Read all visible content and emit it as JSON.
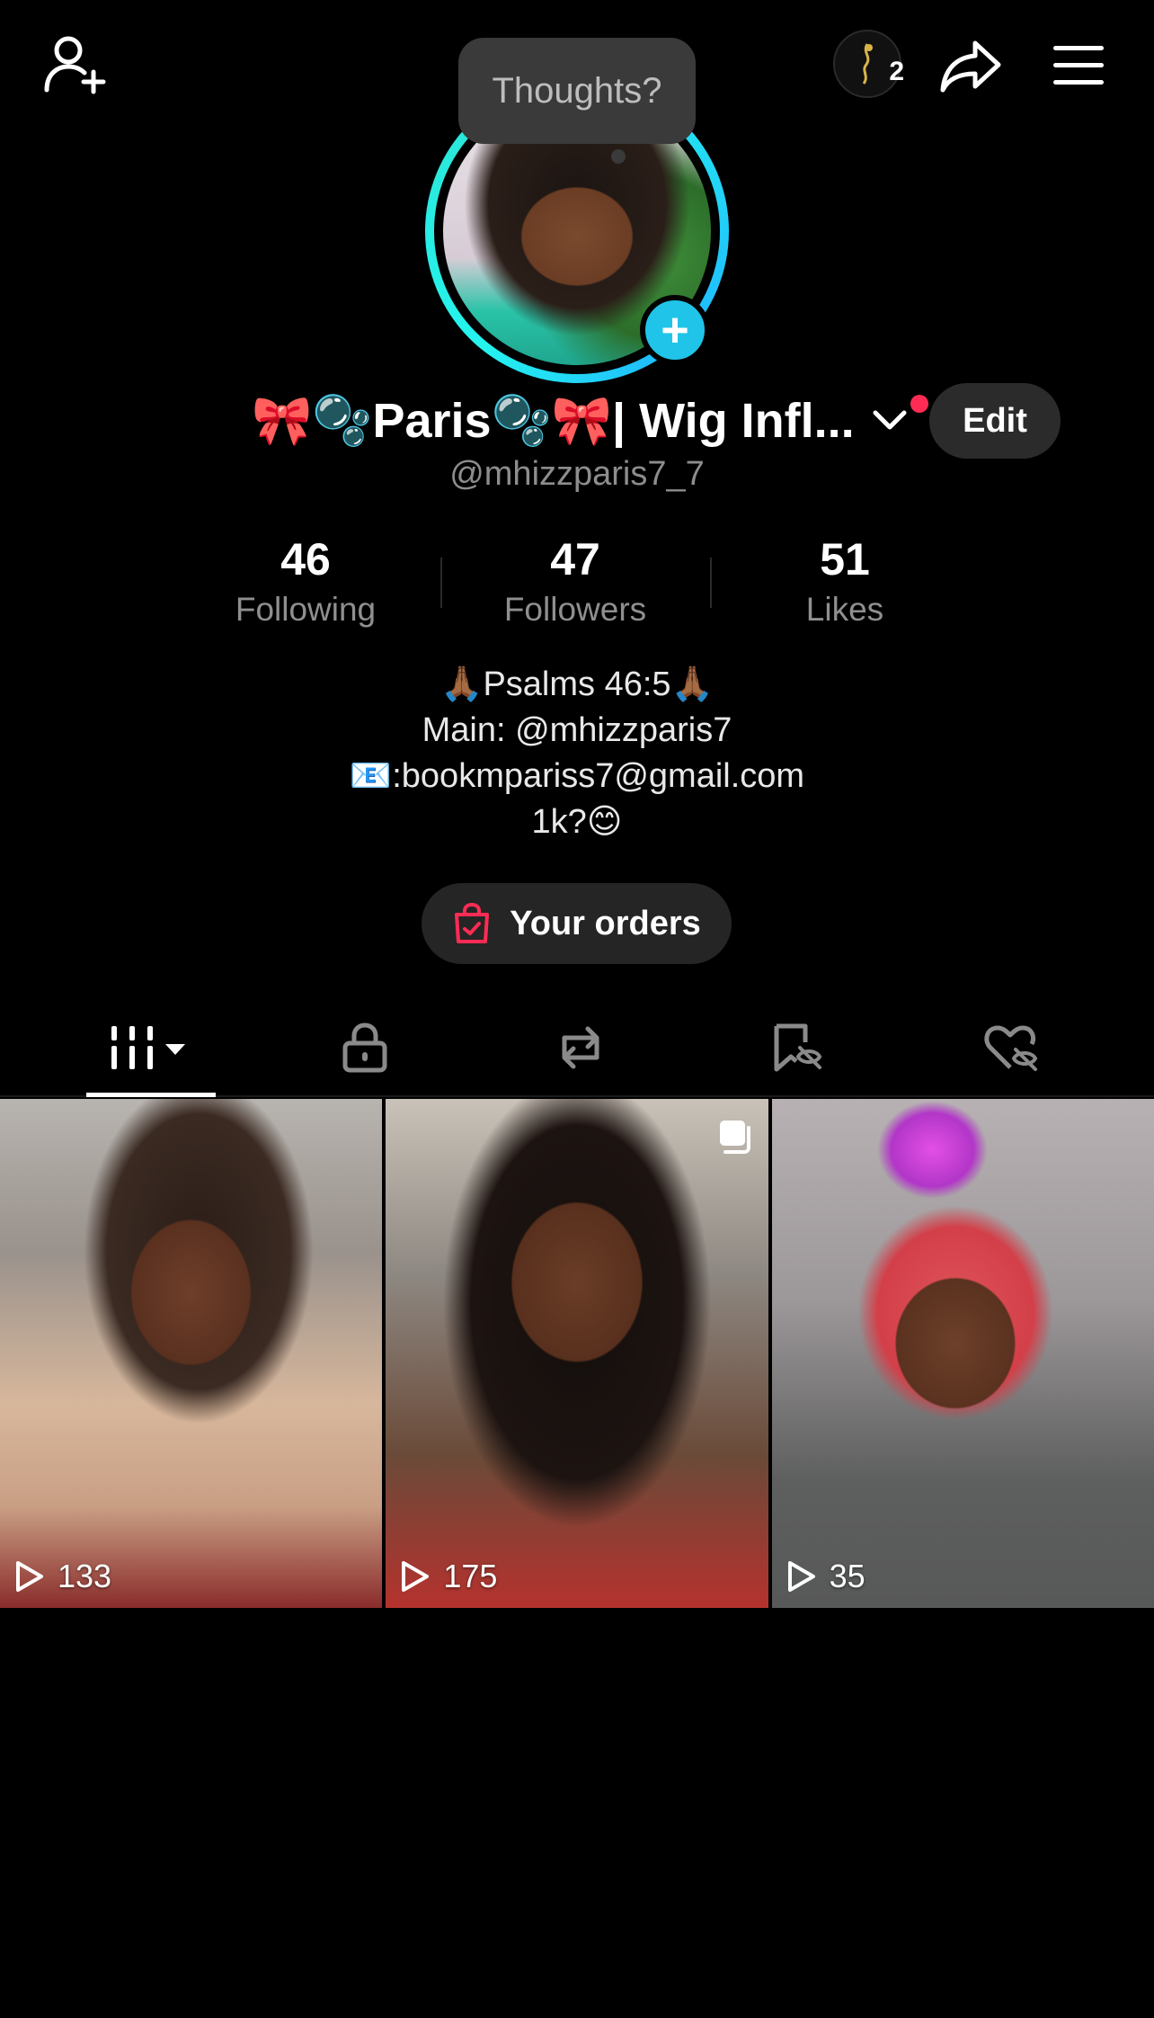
{
  "top_bar": {
    "icons": [
      "add-friend-icon",
      "badge-logo",
      "share-icon",
      "menu-icon"
    ],
    "badge_count": "2"
  },
  "thoughts": {
    "label": "Thoughts?"
  },
  "profile": {
    "display_name": "🎀🫧Paris🫧🎀| Wig Infl...",
    "username": "@mhizzparis7_7",
    "edit_label": "Edit"
  },
  "stats": [
    {
      "value": "46",
      "label": "Following"
    },
    {
      "value": "47",
      "label": "Followers"
    },
    {
      "value": "51",
      "label": "Likes"
    }
  ],
  "bio": {
    "lines": [
      "🙏🏾Psalms 46:5🙏🏾",
      "Main: @mhizzparis7",
      "📧:bookmpariss7@gmail.com",
      "1k?😊"
    ]
  },
  "orders": {
    "label": "Your orders"
  },
  "tabs": [
    {
      "name": "videos",
      "icon": "grid-icon",
      "active": true
    },
    {
      "name": "private",
      "icon": "lock-icon",
      "active": false
    },
    {
      "name": "reposts",
      "icon": "repost-icon",
      "active": false
    },
    {
      "name": "favorites",
      "icon": "bookmark-hidden-icon",
      "active": false
    },
    {
      "name": "liked",
      "icon": "heart-hidden-icon",
      "active": false
    }
  ],
  "videos": [
    {
      "plays": "133",
      "multi": false
    },
    {
      "plays": "175",
      "multi": true
    },
    {
      "plays": "35",
      "multi": false
    }
  ],
  "colors": {
    "accent_cyan": "#25f4ee",
    "plus_blue": "#20c4e8",
    "notif_red": "#fe2c55",
    "order_bag": "#fe2c55"
  }
}
